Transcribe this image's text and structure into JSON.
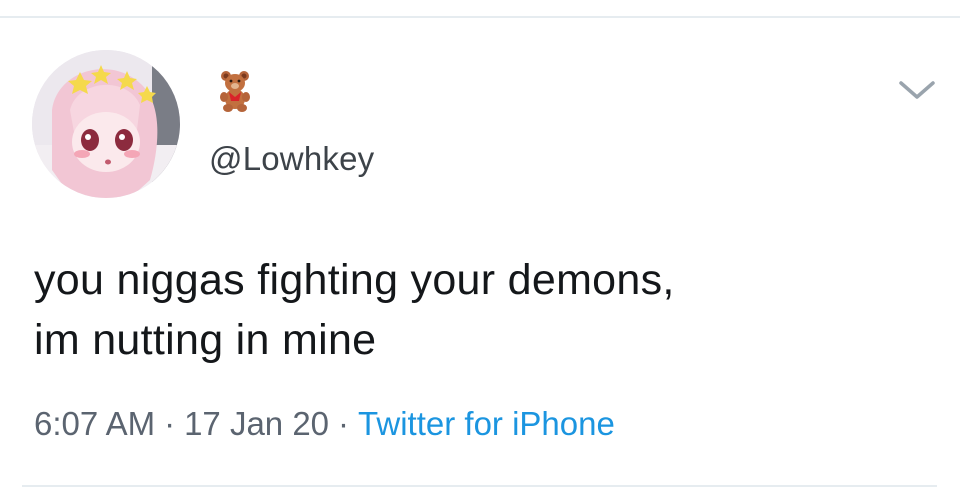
{
  "tweet": {
    "handle": "@Lowhkey",
    "text_lines": [
      "you niggas fighting your demons,",
      "im nutting in mine"
    ],
    "time": "6:07 AM",
    "separator": "·",
    "date": "17 Jan 20",
    "source": "Twitter for iPhone"
  },
  "icons": {
    "display_name": "teddy-bear-emoji-icon",
    "menu": "chevron-down-icon",
    "avatar": "avatar-image"
  },
  "colors": {
    "link": "#1b95e0",
    "text": "#14171a",
    "muted": "#5b6470",
    "divider": "#e6ecf0"
  }
}
